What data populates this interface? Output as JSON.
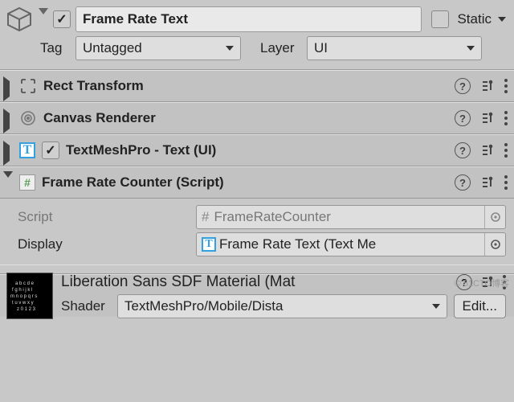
{
  "header": {
    "name": "Frame Rate Text",
    "active": true,
    "static_label": "Static",
    "static_checked": false,
    "tag_label": "Tag",
    "tag_value": "Untagged",
    "layer_label": "Layer",
    "layer_value": "UI"
  },
  "components": [
    {
      "title": "Rect Transform",
      "expanded": false,
      "icon": "rect",
      "has_checkbox": false
    },
    {
      "title": "Canvas Renderer",
      "expanded": false,
      "icon": "target",
      "has_checkbox": false
    },
    {
      "title": "TextMeshPro - Text (UI)",
      "expanded": false,
      "icon": "text",
      "has_checkbox": true,
      "checked": true
    },
    {
      "title": "Frame Rate Counter (Script)",
      "expanded": true,
      "icon": "script",
      "has_checkbox": false
    }
  ],
  "frc": {
    "script_label": "Script",
    "script_value": "FrameRateCounter",
    "display_label": "Display",
    "display_value": "Frame Rate Text (Text Me"
  },
  "material": {
    "name": "Liberation Sans SDF Material (Mat",
    "shader_label": "Shader",
    "shader_value": "TextMeshPro/Mobile/Dista",
    "edit_label": "Edit..."
  },
  "watermark": "© 51CTO博客"
}
